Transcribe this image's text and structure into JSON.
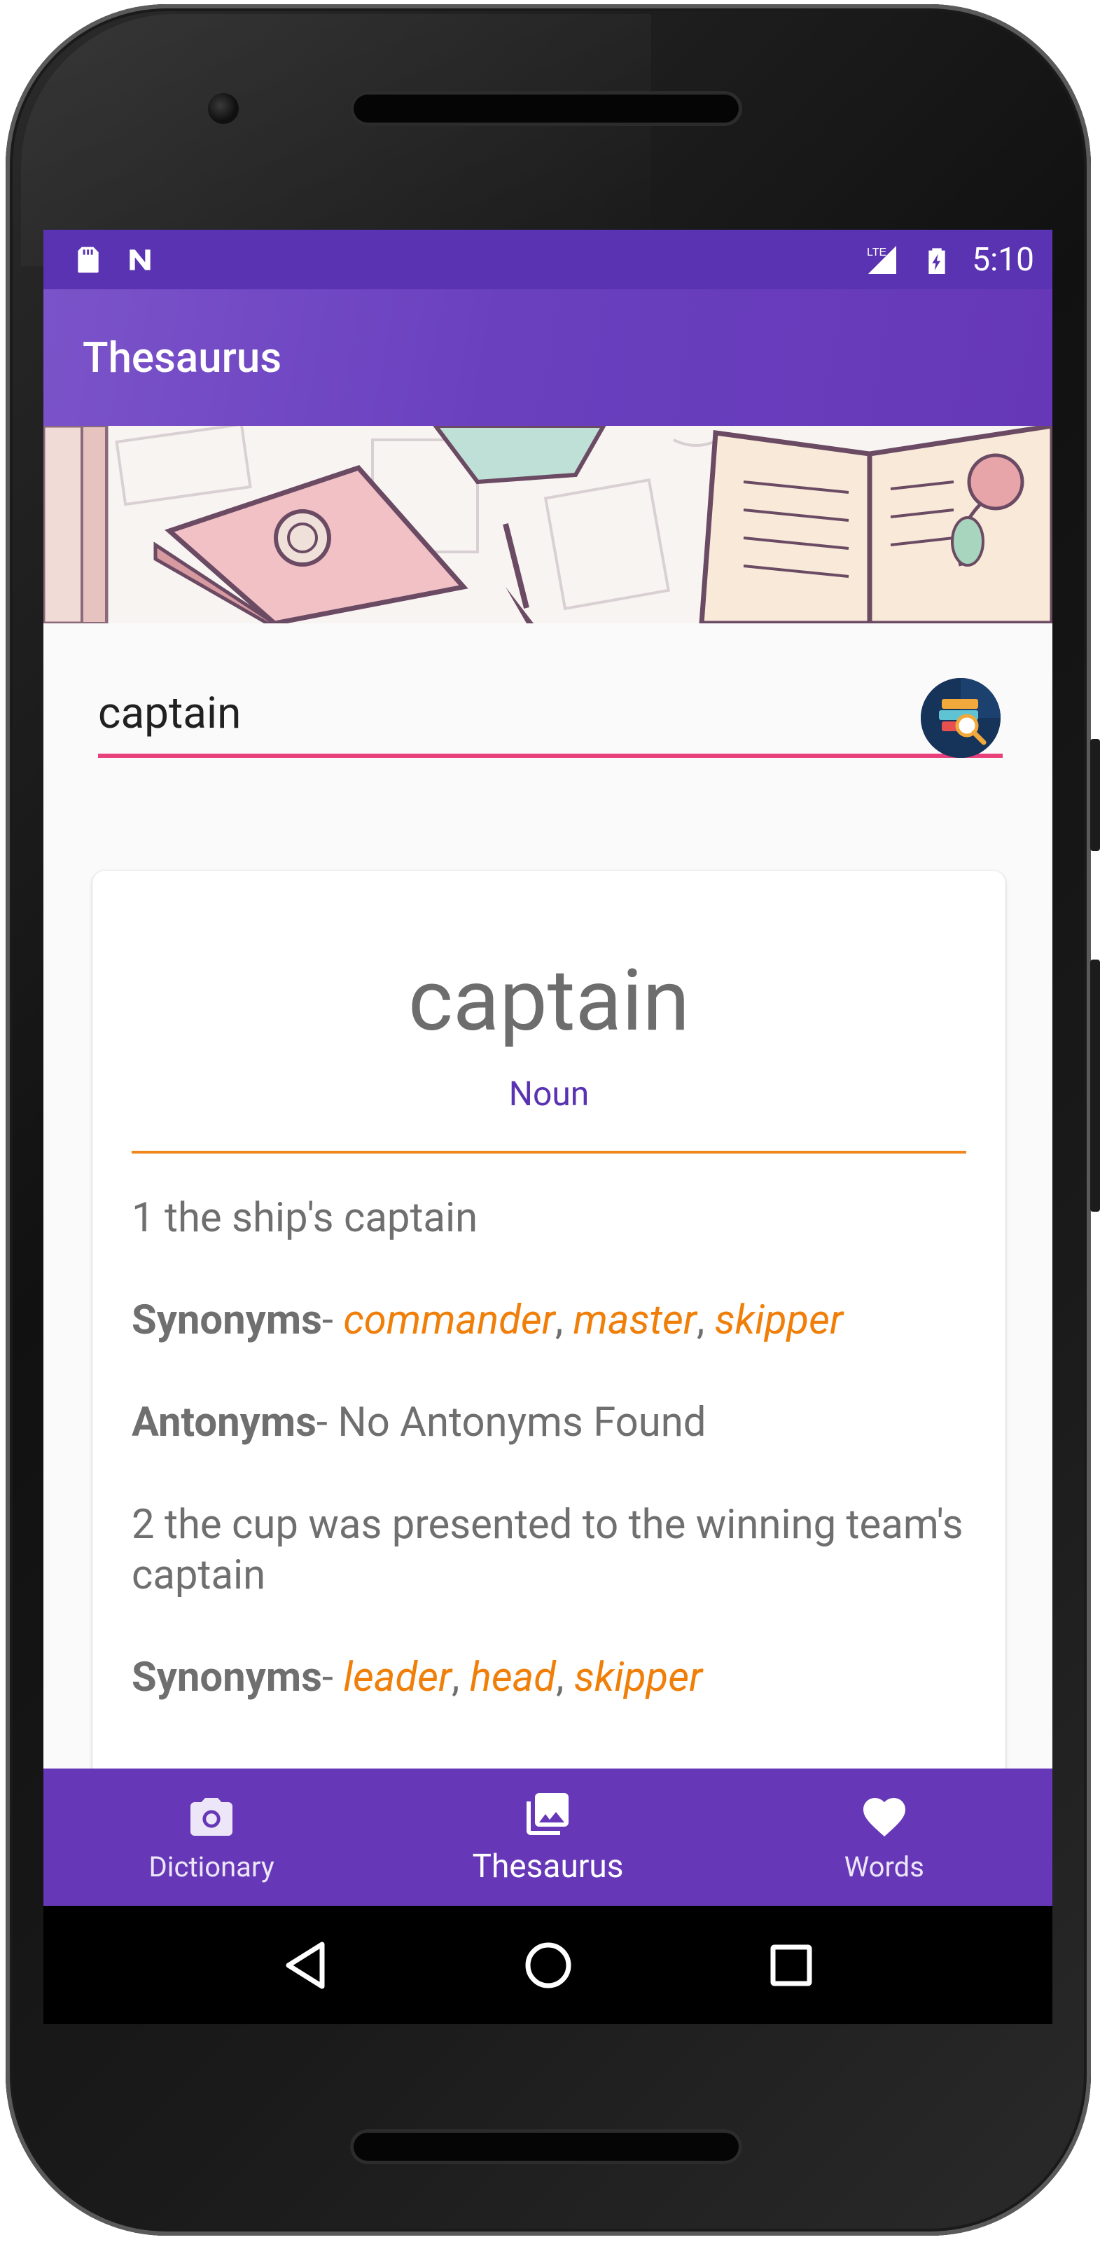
{
  "status_bar": {
    "time": "5:10",
    "network_label": "LTE",
    "left_icons": [
      "sd-card-icon",
      "notification-n-icon"
    ],
    "right_icons": [
      "lte-signal-icon",
      "battery-charging-icon"
    ]
  },
  "app_bar": {
    "title": "Thesaurus"
  },
  "banner": {
    "image": "books-illustration"
  },
  "search": {
    "value": "captain",
    "button_icon": "book-search-icon",
    "underline_color": "#e8407a"
  },
  "result": {
    "word": "captain",
    "part_of_speech": "Noun",
    "entries": [
      {
        "definition": "1 the ship's captain",
        "synonyms_label": "Synonyms",
        "synonyms": [
          "commander",
          "master",
          "skipper"
        ],
        "antonyms_label": "Antonyms",
        "antonyms_text": "No Antonyms Found"
      },
      {
        "definition": "2 the cup was presented to the winning team's captain",
        "synonyms_label": "Synonyms",
        "synonyms": [
          "leader",
          "head",
          "skipper"
        ]
      }
    ]
  },
  "bottom_nav": {
    "items": [
      {
        "label": "Dictionary",
        "icon": "camera-icon"
      },
      {
        "label": "Thesaurus",
        "icon": "photo-library-icon",
        "active": true
      },
      {
        "label": "Words",
        "icon": "heart-icon"
      }
    ]
  },
  "system_nav": {
    "buttons": [
      "back-icon",
      "home-icon",
      "recents-icon"
    ]
  },
  "colors": {
    "primary": "#6638b8",
    "primary_dark": "#5a33b2",
    "accent": "#f07f0a",
    "search_underline": "#e8407a",
    "text_gray": "#6f6f6f"
  }
}
